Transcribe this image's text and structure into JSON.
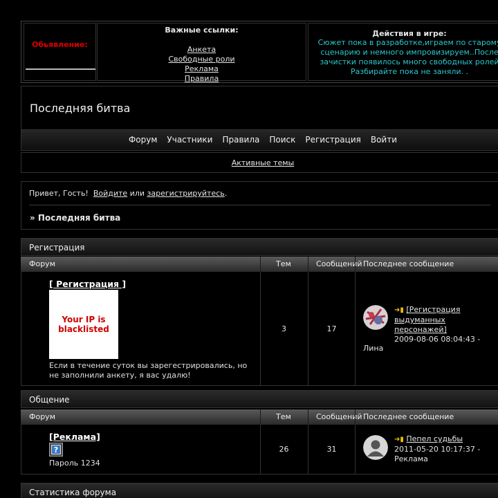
{
  "announcement": {
    "title": "Обьявление:",
    "links_title": "Важные ссылки:",
    "links": [
      "Анкета",
      "Свободные роли ",
      "Реклама",
      "Правила"
    ],
    "actions_title": "Действия в игре:",
    "actions_text": "Сюжет пока в разработке,играем по старому\nсценарию и немного импровизируем..После\nзачистки появилось много свободных ролей\nРазбирайте пока не заняли. ."
  },
  "header": {
    "site_title": "Последняя битва"
  },
  "nav": {
    "items": [
      "Форум",
      "Участники",
      "Правила",
      "Поиск",
      "Регистрация",
      "Войти"
    ],
    "active_topics": "Активные темы"
  },
  "greeting": {
    "hello": "Привет, Гость!",
    "login": "Войдите",
    "or": "или",
    "register": "зарегистрируйтесь",
    "dot": ".",
    "crumb": "» Последняя битва"
  },
  "columns": {
    "forum": "Форум",
    "topics": "Тем",
    "posts": "Сообщений",
    "last_post": "Последнее сообщение"
  },
  "categories": [
    {
      "title": "Регистрация",
      "forum": {
        "name": "[ Регистрация ]",
        "image_text": "Your IP is\nblacklisted",
        "description": "Если в течение суток вы зарегестрировались, но\nне заполнили анкету, я вас удалю!",
        "topics": "3",
        "posts": "17",
        "last_post": {
          "title": "[Регистрация\nвыдуманных\nперсонажей]",
          "date": "2009-08-06 08:04:43 -",
          "author": "Лина"
        }
      }
    },
    {
      "title": "Общение",
      "forum": {
        "name": "[Реклама]",
        "description": "Пароль 1234",
        "topics": "26",
        "posts": "31",
        "last_post": {
          "title": "Пепел судьбы",
          "date": "2011-05-20 10:17:37 -",
          "author": "Реклама"
        }
      }
    }
  ],
  "stats": {
    "title": "Статистика форума"
  },
  "icons": {
    "new_post": "arrow-page-icon",
    "forum_icon": "question-icon",
    "avatar_default": "user-silhouette-icon"
  }
}
